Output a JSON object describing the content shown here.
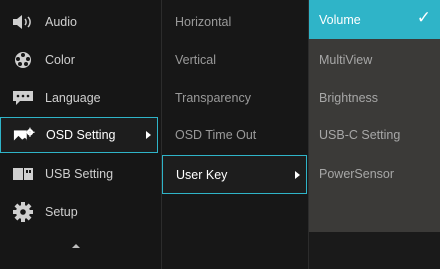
{
  "main_menu": {
    "items": [
      {
        "label": "Audio",
        "icon": "speaker-icon"
      },
      {
        "label": "Color",
        "icon": "color-palette-icon"
      },
      {
        "label": "Language",
        "icon": "language-icon"
      },
      {
        "label": "OSD Setting",
        "icon": "osd-setting-icon",
        "selected": true
      },
      {
        "label": "USB Setting",
        "icon": "usb-icon"
      },
      {
        "label": "Setup",
        "icon": "gear-icon"
      }
    ]
  },
  "submenu": {
    "items": [
      {
        "label": "Horizontal"
      },
      {
        "label": "Vertical"
      },
      {
        "label": "Transparency"
      },
      {
        "label": "OSD Time Out"
      },
      {
        "label": "User Key",
        "selected": true
      }
    ]
  },
  "options": {
    "items": [
      {
        "label": "Volume",
        "selected": true,
        "checked": true
      },
      {
        "label": "MultiView"
      },
      {
        "label": "Brightness"
      },
      {
        "label": "USB-C Setting"
      },
      {
        "label": "PowerSensor"
      }
    ]
  },
  "colors": {
    "accent": "#2fb4c8",
    "background": "#161616",
    "option_panel": "#3b3a38"
  }
}
